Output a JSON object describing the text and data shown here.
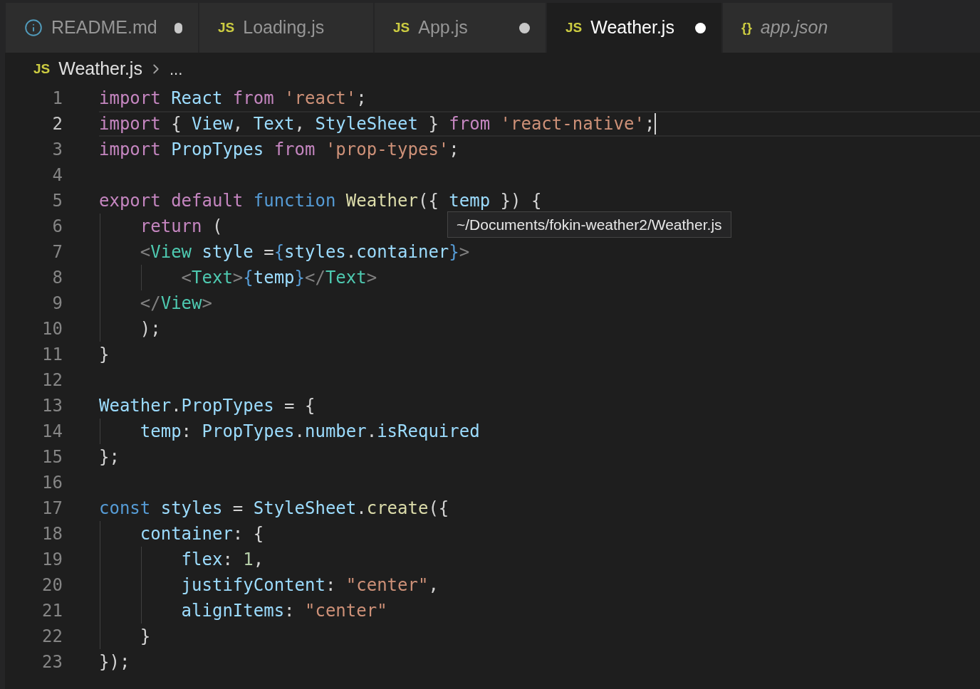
{
  "tabs": [
    {
      "kind": "info",
      "label": "README.md",
      "dirty": true,
      "selected": false,
      "preview": false
    },
    {
      "kind": "file",
      "badge": "JS",
      "label": "Loading.js",
      "dirty": false,
      "selected": false,
      "preview": false
    },
    {
      "kind": "file",
      "badge": "JS",
      "label": "App.js",
      "dirty": true,
      "selected": false,
      "preview": false
    },
    {
      "kind": "file",
      "badge": "JS",
      "label": "Weather.js",
      "dirty": true,
      "selected": true,
      "preview": false
    },
    {
      "kind": "file",
      "badge": "{}",
      "label": "app.json",
      "dirty": false,
      "selected": false,
      "preview": true
    }
  ],
  "breadcrumbs": {
    "badge": "JS",
    "file": "Weather.js",
    "more": "..."
  },
  "lines": [
    {
      "number": "1",
      "current": false,
      "tokens": [
        {
          "text": "import",
          "kind": "keyword"
        },
        {
          "text": " React ",
          "kind": "variable"
        },
        {
          "text": "from",
          "kind": "keyword"
        },
        {
          "text": " 'react'",
          "kind": "string"
        },
        {
          "text": ";",
          "kind": "plain"
        }
      ]
    },
    {
      "number": "2",
      "current": true,
      "tokens": [
        {
          "text": "import",
          "kind": "keyword"
        },
        {
          "text": " { ",
          "kind": "plain"
        },
        {
          "text": "View",
          "kind": "variable"
        },
        {
          "text": ", ",
          "kind": "plain"
        },
        {
          "text": "Text",
          "kind": "variable"
        },
        {
          "text": ", ",
          "kind": "plain"
        },
        {
          "text": "StyleSheet",
          "kind": "variable"
        },
        {
          "text": " } ",
          "kind": "plain"
        },
        {
          "text": "from",
          "kind": "keyword"
        },
        {
          "text": " 'react-native'",
          "kind": "string"
        },
        {
          "text": ";",
          "kind": "plain"
        }
      ]
    },
    {
      "number": "3",
      "current": false,
      "tokens": [
        {
          "text": "import",
          "kind": "keyword"
        },
        {
          "text": " PropTypes ",
          "kind": "variable"
        },
        {
          "text": "from",
          "kind": "keyword"
        },
        {
          "text": " 'prop-types'",
          "kind": "string"
        },
        {
          "text": ";",
          "kind": "plain"
        }
      ]
    },
    {
      "number": "4",
      "current": false
    },
    {
      "number": "5",
      "current": false,
      "tokens": [
        {
          "text": "export default",
          "kind": "keyword"
        },
        {
          "text": " function",
          "kind": "storage"
        },
        {
          "text": " Weather",
          "kind": "function"
        },
        {
          "text": "({ ",
          "kind": "plain"
        },
        {
          "text": "temp",
          "kind": "variable"
        },
        {
          "text": " }) {",
          "kind": "plain"
        }
      ]
    },
    {
      "number": "6",
      "current": false,
      "tokens": [
        {
          "text": "    return",
          "kind": "keyword"
        },
        {
          "text": " (",
          "kind": "plain"
        }
      ]
    },
    {
      "number": "7",
      "current": false,
      "tokens": [
        {
          "text": "    <",
          "kind": "bracket"
        },
        {
          "text": "View",
          "kind": "tag"
        },
        {
          "text": " style ",
          "kind": "variable"
        },
        {
          "text": "=",
          "kind": "plain"
        },
        {
          "text": "{",
          "kind": "storage"
        },
        {
          "text": "styles",
          "kind": "variable"
        },
        {
          "text": ".",
          "kind": "plain"
        },
        {
          "text": "container",
          "kind": "variable"
        },
        {
          "text": "}",
          "kind": "storage"
        },
        {
          "text": ">",
          "kind": "bracket"
        }
      ]
    },
    {
      "number": "8",
      "current": false,
      "tokens": [
        {
          "text": "        <",
          "kind": "bracket"
        },
        {
          "text": "Text",
          "kind": "tag"
        },
        {
          "text": ">",
          "kind": "bracket"
        },
        {
          "text": "{",
          "kind": "storage"
        },
        {
          "text": "temp",
          "kind": "variable"
        },
        {
          "text": "}",
          "kind": "storage"
        },
        {
          "text": "</",
          "kind": "bracket"
        },
        {
          "text": "Text",
          "kind": "tag"
        },
        {
          "text": ">",
          "kind": "bracket"
        }
      ]
    },
    {
      "number": "9",
      "current": false,
      "tokens": [
        {
          "text": "    </",
          "kind": "bracket"
        },
        {
          "text": "View",
          "kind": "tag"
        },
        {
          "text": ">",
          "kind": "bracket"
        }
      ]
    },
    {
      "number": "10",
      "current": false,
      "tokens": [
        {
          "text": "    );",
          "kind": "plain"
        }
      ]
    },
    {
      "number": "11",
      "current": false,
      "tokens": [
        {
          "text": "}",
          "kind": "plain"
        }
      ]
    },
    {
      "number": "12",
      "current": false
    },
    {
      "number": "13",
      "current": false,
      "tokens": [
        {
          "text": "Weather",
          "kind": "variable"
        },
        {
          "text": ".",
          "kind": "plain"
        },
        {
          "text": "PropTypes",
          "kind": "variable"
        },
        {
          "text": " = {",
          "kind": "plain"
        }
      ]
    },
    {
      "number": "14",
      "current": false,
      "tokens": [
        {
          "text": "    temp",
          "kind": "variable"
        },
        {
          "text": ": ",
          "kind": "plain"
        },
        {
          "text": "PropTypes",
          "kind": "variable"
        },
        {
          "text": ".",
          "kind": "plain"
        },
        {
          "text": "number",
          "kind": "variable"
        },
        {
          "text": ".",
          "kind": "plain"
        },
        {
          "text": "isRequired",
          "kind": "variable"
        }
      ]
    },
    {
      "number": "15",
      "current": false,
      "tokens": [
        {
          "text": "};",
          "kind": "plain"
        }
      ]
    },
    {
      "number": "16",
      "current": false
    },
    {
      "number": "17",
      "current": false,
      "tokens": [
        {
          "text": "const",
          "kind": "storage"
        },
        {
          "text": " styles ",
          "kind": "variable"
        },
        {
          "text": "= ",
          "kind": "plain"
        },
        {
          "text": "StyleSheet",
          "kind": "variable"
        },
        {
          "text": ".",
          "kind": "plain"
        },
        {
          "text": "create",
          "kind": "function"
        },
        {
          "text": "({",
          "kind": "plain"
        }
      ]
    },
    {
      "number": "18",
      "current": false,
      "tokens": [
        {
          "text": "    container",
          "kind": "variable"
        },
        {
          "text": ": {",
          "kind": "plain"
        }
      ]
    },
    {
      "number": "19",
      "current": false,
      "tokens": [
        {
          "text": "        flex",
          "kind": "variable"
        },
        {
          "text": ": ",
          "kind": "plain"
        },
        {
          "text": "1",
          "kind": "number"
        },
        {
          "text": ",",
          "kind": "plain"
        }
      ]
    },
    {
      "number": "20",
      "current": false,
      "tokens": [
        {
          "text": "        justifyContent",
          "kind": "variable"
        },
        {
          "text": ": ",
          "kind": "plain"
        },
        {
          "text": "\"center\"",
          "kind": "string"
        },
        {
          "text": ",",
          "kind": "plain"
        }
      ]
    },
    {
      "number": "21",
      "current": false,
      "tokens": [
        {
          "text": "        alignItems",
          "kind": "variable"
        },
        {
          "text": ": ",
          "kind": "plain"
        },
        {
          "text": "\"center\"",
          "kind": "string"
        }
      ]
    },
    {
      "number": "22",
      "current": false,
      "tokens": [
        {
          "text": "    }",
          "kind": "plain"
        }
      ]
    },
    {
      "number": "23",
      "current": false,
      "tokens": [
        {
          "text": "});",
          "kind": "plain"
        }
      ]
    }
  ],
  "tooltip": {
    "text": "~/Documents/fokin-weather2/Weather.js"
  }
}
